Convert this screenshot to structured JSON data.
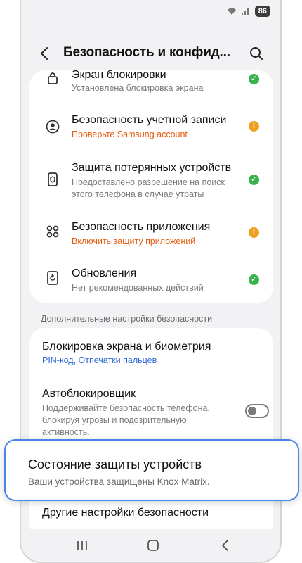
{
  "status": {
    "battery": "86"
  },
  "header": {
    "title": "Безопасность и конфид..."
  },
  "security_items": [
    {
      "title": "Экран блокировки",
      "subtitle": "Установлена блокировка экрана",
      "state": "ok"
    },
    {
      "title": "Безопасность учетной записи",
      "subtitle": "Проверьте Samsung account",
      "state": "warning"
    },
    {
      "title": "Защита потерянных устройств",
      "subtitle": "Предоставлено разрешение на поиск этого телефона в случае утраты",
      "state": "ok"
    },
    {
      "title": "Безопасность приложения",
      "subtitle": "Включить защиту приложений",
      "state": "warning"
    },
    {
      "title": "Обновления",
      "subtitle": "Нет рекомендованных действий",
      "state": "ok"
    }
  ],
  "section": {
    "label": "Дополнительные настройки безопасности"
  },
  "advanced": {
    "biometrics_title": "Блокировка экрана и биометрия",
    "biometrics_sub": "PIN-код, Отпечатки пальцев",
    "autoblocker_title": "Автоблокировщик",
    "autoblocker_sub": "Поддерживайте безопасность телефона, блокируя угрозы и подозрительную активность.",
    "autoblocker_on": false,
    "other_title": "Другие настройки безопасности"
  },
  "popup": {
    "title": "Состояние защиты устройств",
    "subtitle": "Ваши устройства защищены Knox Matrix."
  },
  "colors": {
    "ok": "#36b34a",
    "warning": "#f0a020",
    "warning_text": "#e8590c",
    "link": "#2f6ad8",
    "highlight_border": "#4a86e8"
  }
}
